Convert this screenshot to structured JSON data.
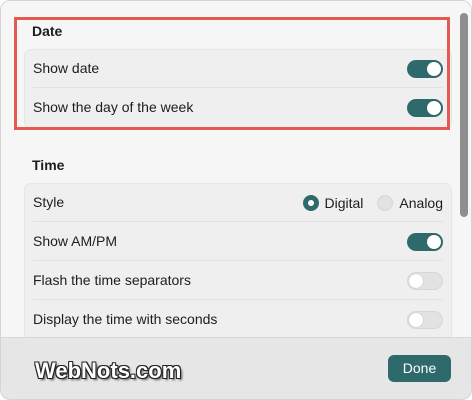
{
  "date_section": {
    "title": "Date",
    "rows": [
      {
        "label": "Show date",
        "enabled": true
      },
      {
        "label": "Show the day of the week",
        "enabled": true
      }
    ]
  },
  "time_section": {
    "title": "Time",
    "style": {
      "label": "Style",
      "options": [
        "Digital",
        "Analog"
      ],
      "selected": "Digital"
    },
    "rows": [
      {
        "label": "Show AM/PM",
        "enabled": true
      },
      {
        "label": "Flash the time separators",
        "enabled": false
      },
      {
        "label": "Display the time with seconds",
        "enabled": false
      }
    ]
  },
  "footer": {
    "watermark": "WebNots.com",
    "done_label": "Done"
  },
  "colors": {
    "accent": "#2e6a6c",
    "highlight_border": "#e35b4f"
  }
}
